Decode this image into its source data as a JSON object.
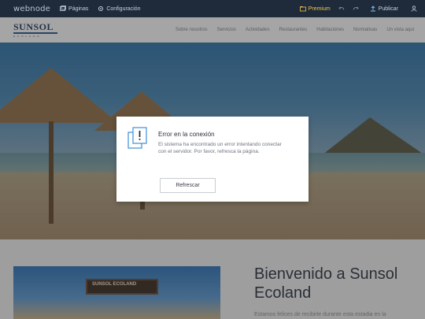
{
  "editor": {
    "logo": "webnode",
    "pages_label": "Páginas",
    "settings_label": "Configuración",
    "premium_label": "Premium",
    "publish_label": "Publicar"
  },
  "site": {
    "brand_name": "SUNSOL",
    "brand_sub": "ECOLAND",
    "nav": [
      "Sobre nosotros",
      "Servicios",
      "Actividades",
      "Restaurantes",
      "Habitaciones",
      "Normativas",
      "Un vista aqui"
    ]
  },
  "content": {
    "heading": "Bienvenido a Sunsol Ecoland",
    "teaser": "Estamos felices de recibirle durante esta estadia en la",
    "sign_text": "SUNSOL ECOLAND"
  },
  "dialog": {
    "title": "Error en la conexión",
    "message": "El sistema ha encontrado un error intentando conectar con el servidor. Por favor, refresca la página.",
    "button_label": "Refrescar",
    "icon": "document-warning-icon"
  },
  "colors": {
    "toolbar_bg": "#1f2b3b",
    "premium": "#f5c542",
    "overlay": "rgba(40,40,40,0.42)"
  }
}
